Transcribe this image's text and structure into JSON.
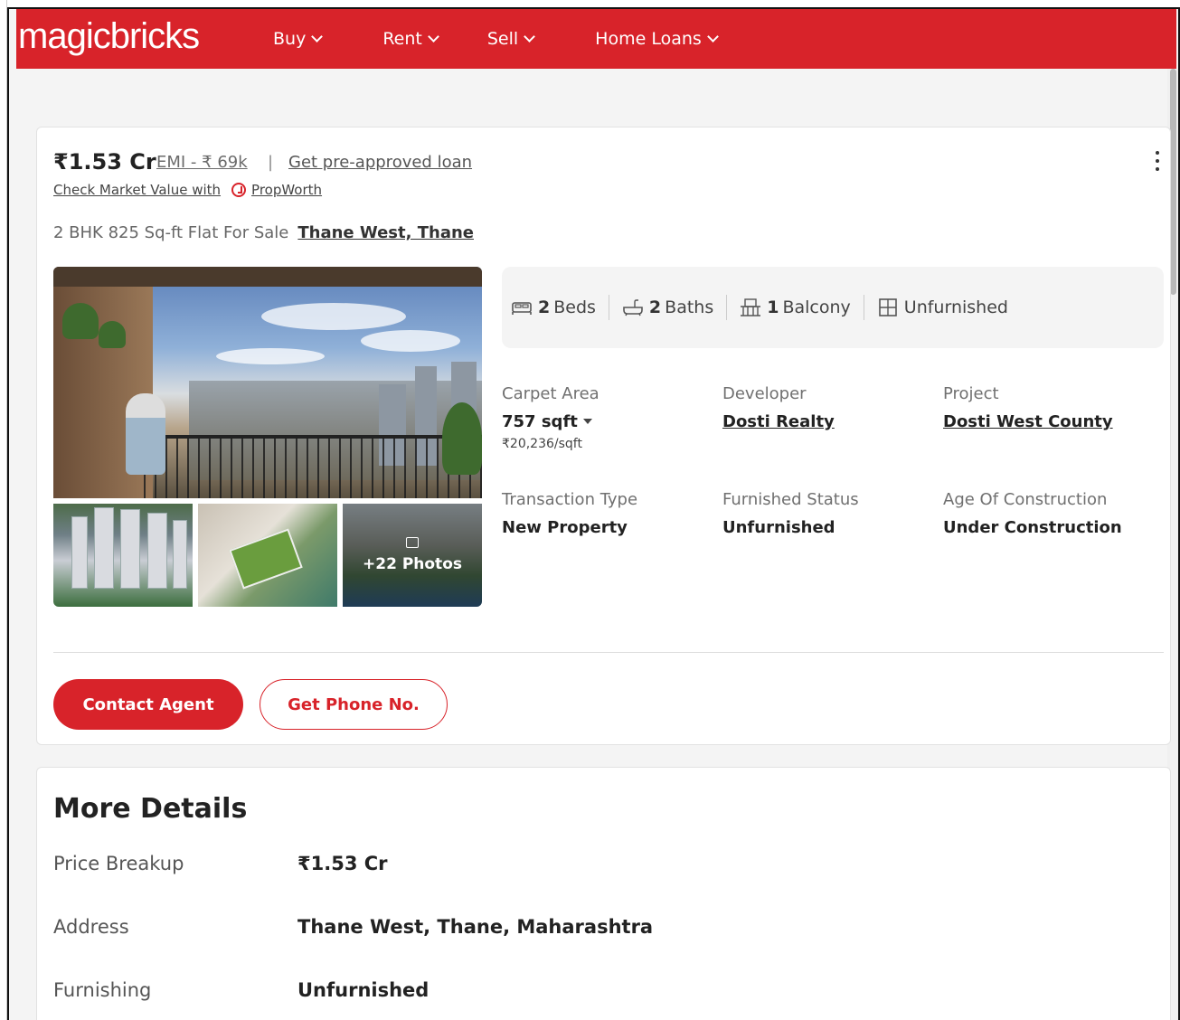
{
  "header": {
    "logo": "magicbricks",
    "nav": [
      {
        "label": "Buy"
      },
      {
        "label": "Rent"
      },
      {
        "label": "Sell"
      },
      {
        "label": "Home Loans"
      }
    ]
  },
  "listing": {
    "price": "₹1.53 Cr",
    "emi": "EMI - ₹ 69k",
    "separator": "|",
    "preapproved": "Get pre-approved loan",
    "market_value": "Check Market Value with",
    "propworth": "PropWorth",
    "title": "2 BHK 825 Sq-ft Flat For Sale",
    "location": "Thane West, Thane",
    "photos_more": "+22 Photos",
    "summary": {
      "beds_num": "2",
      "beds_label": "Beds",
      "baths_num": "2",
      "baths_label": "Baths",
      "balcony_num": "1",
      "balcony_label": "Balcony",
      "furnish": "Unfurnished"
    },
    "specs": {
      "carpet_label": "Carpet Area",
      "carpet_value": "757 sqft",
      "carpet_rate": "₹20,236/sqft",
      "developer_label": "Developer",
      "developer_value": "Dosti Realty",
      "project_label": "Project",
      "project_value": "Dosti West County",
      "transaction_label": "Transaction Type",
      "transaction_value": "New Property",
      "furnished_label": "Furnished Status",
      "furnished_value": "Unfurnished",
      "age_label": "Age Of Construction",
      "age_value": "Under Construction"
    },
    "contact_button": "Contact Agent",
    "phone_button": "Get Phone No."
  },
  "more_details": {
    "title": "More Details",
    "rows": [
      {
        "key": "Price Breakup",
        "value": "₹1.53 Cr"
      },
      {
        "key": "Address",
        "value": "Thane West, Thane, Maharashtra"
      },
      {
        "key": "Furnishing",
        "value": "Unfurnished"
      }
    ]
  },
  "colors": {
    "brand": "#d8232a",
    "page_bg": "#f4f4f4"
  }
}
